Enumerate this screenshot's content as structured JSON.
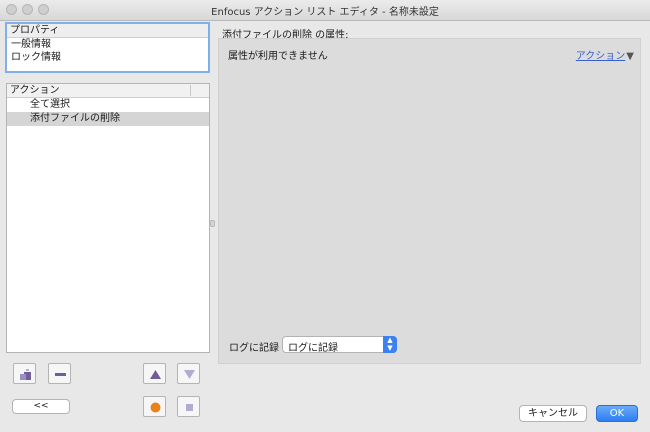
{
  "window": {
    "title": "Enfocus アクション リスト エディタ - 名称未設定"
  },
  "properties": {
    "header": "プロパティ",
    "items": [
      "一般情報",
      "ロック情報"
    ]
  },
  "actions": {
    "header": "アクション",
    "items": [
      "全て選択",
      "添付ファイルの削除"
    ],
    "selected_index": 1
  },
  "attributes": {
    "label": "添付ファイルの削除 の属性:",
    "message": "属性が利用できません",
    "action_link": "アクション",
    "log_label": "ログに記録",
    "log_value": "ログに記録"
  },
  "toolbar": {
    "collapse_label": "<<",
    "record_color": "#e8811a"
  },
  "dialog": {
    "cancel_label": "キャンセル",
    "ok_label": "OK"
  }
}
